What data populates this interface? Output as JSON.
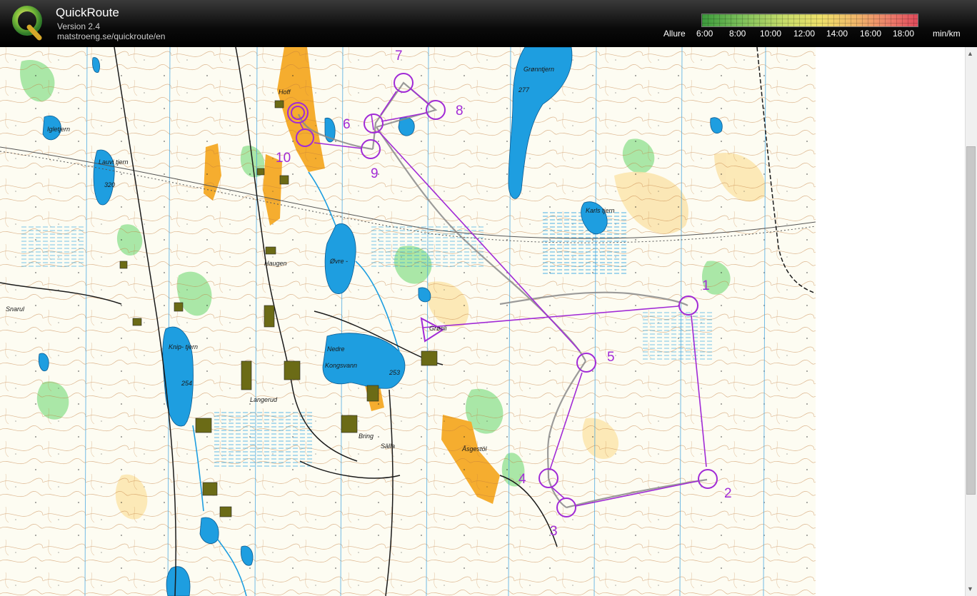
{
  "header": {
    "title": "QuickRoute",
    "version": "Version 2.4",
    "url": "matstroeng.se/quickroute/en"
  },
  "pace_legend": {
    "caption": "Allure",
    "ticks": [
      "6:00",
      "8:00",
      "10:00",
      "12:00",
      "14:00",
      "16:00",
      "18:00"
    ],
    "unit": "min/km"
  },
  "map": {
    "control_labels": [
      "1",
      "2",
      "3",
      "4",
      "5",
      "6",
      "7",
      "8",
      "9",
      "10"
    ],
    "place_names": {
      "hoff": "Hoff",
      "igletjern": "Igletjern",
      "lauvtjern": "Lauvi tjern",
      "elev_320": "320",
      "gronntjern": "Grønntjern",
      "elev_277": "277",
      "karlstjern": "Karls tjern",
      "ovre": "Øvre -",
      "haugen": "Haugen",
      "snarul": "Snarul",
      "knipetjern": "Knip- tjern",
      "elev_254": "254",
      "nedre": "Nedre",
      "kongsvann": "Kongsvann",
      "elev_253": "253",
      "gronli": "Grønli",
      "langerud": "Langerud",
      "bring": "Bring",
      "salla": "Sälla",
      "asgestol": "Åsgestöl"
    },
    "colors": {
      "course": "#a12ad6",
      "water": "#1e9ee0",
      "open_land": "#f5ad2f",
      "green": "#5ecf6a",
      "contour": "#b0662a",
      "route": "#8a8a8a"
    }
  }
}
